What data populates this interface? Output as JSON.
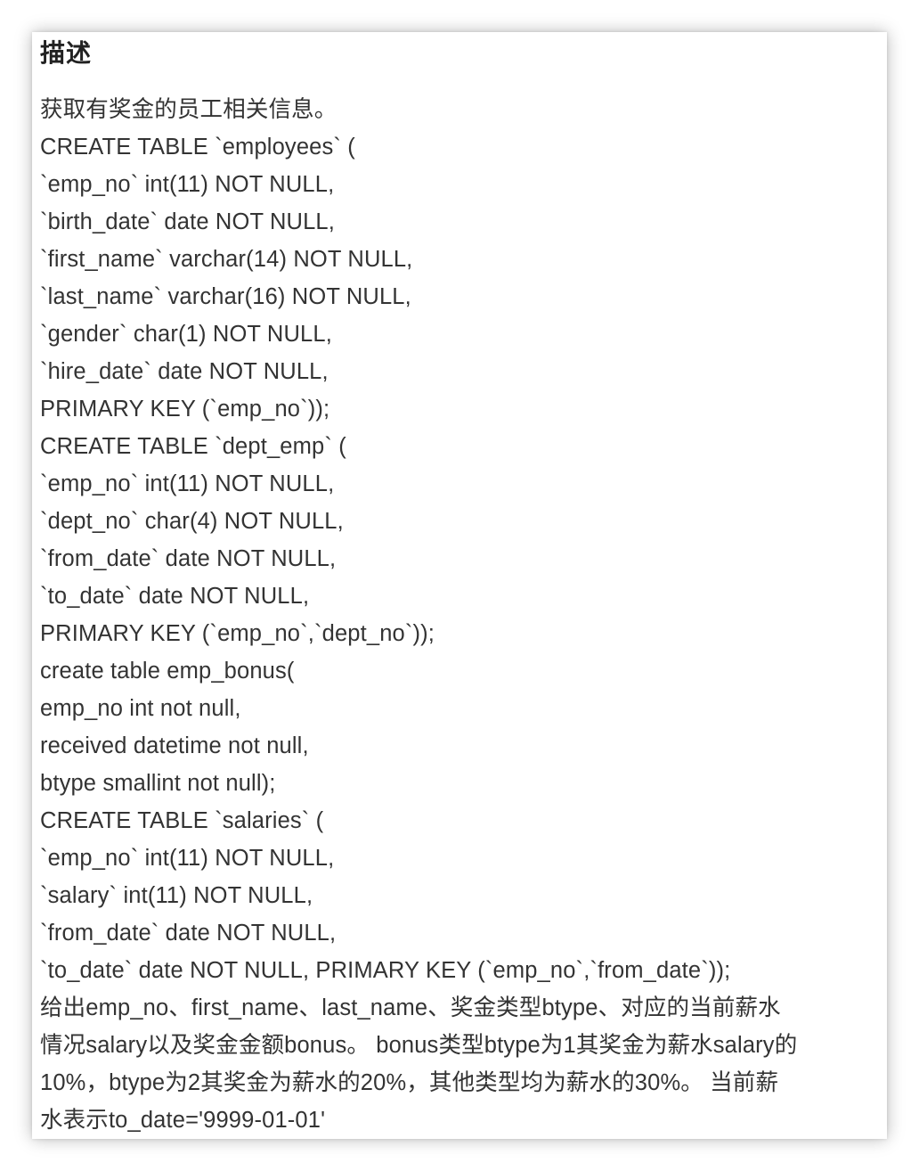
{
  "title": "描述",
  "lines": [
    "获取有奖金的员工相关信息。",
    "CREATE TABLE `employees` (",
    "`emp_no` int(11) NOT NULL,",
    "`birth_date` date NOT NULL,",
    "`first_name` varchar(14) NOT NULL,",
    "`last_name` varchar(16) NOT NULL,",
    "`gender` char(1) NOT NULL,",
    "`hire_date` date NOT NULL,",
    "PRIMARY KEY (`emp_no`));",
    "CREATE TABLE `dept_emp` (",
    "`emp_no` int(11) NOT NULL,",
    "`dept_no` char(4) NOT NULL,",
    "`from_date` date NOT NULL,",
    "`to_date` date NOT NULL,",
    "PRIMARY KEY (`emp_no`,`dept_no`));",
    "create table emp_bonus(",
    "emp_no int not null,",
    "received datetime not null,",
    "btype smallint not null);",
    "CREATE TABLE `salaries` (",
    "`emp_no` int(11) NOT NULL,",
    "`salary` int(11) NOT NULL,",
    "`from_date` date NOT NULL,",
    "`to_date` date NOT NULL, PRIMARY KEY (`emp_no`,`from_date`));",
    "给出emp_no、first_name、last_name、奖金类型btype、对应的当前薪水",
    "情况salary以及奖金金额bonus。 bonus类型btype为1其奖金为薪水salary的",
    "10%，btype为2其奖金为薪水的20%，其他类型均为薪水的30%。 当前薪",
    "水表示to_date='9999-01-01'"
  ]
}
